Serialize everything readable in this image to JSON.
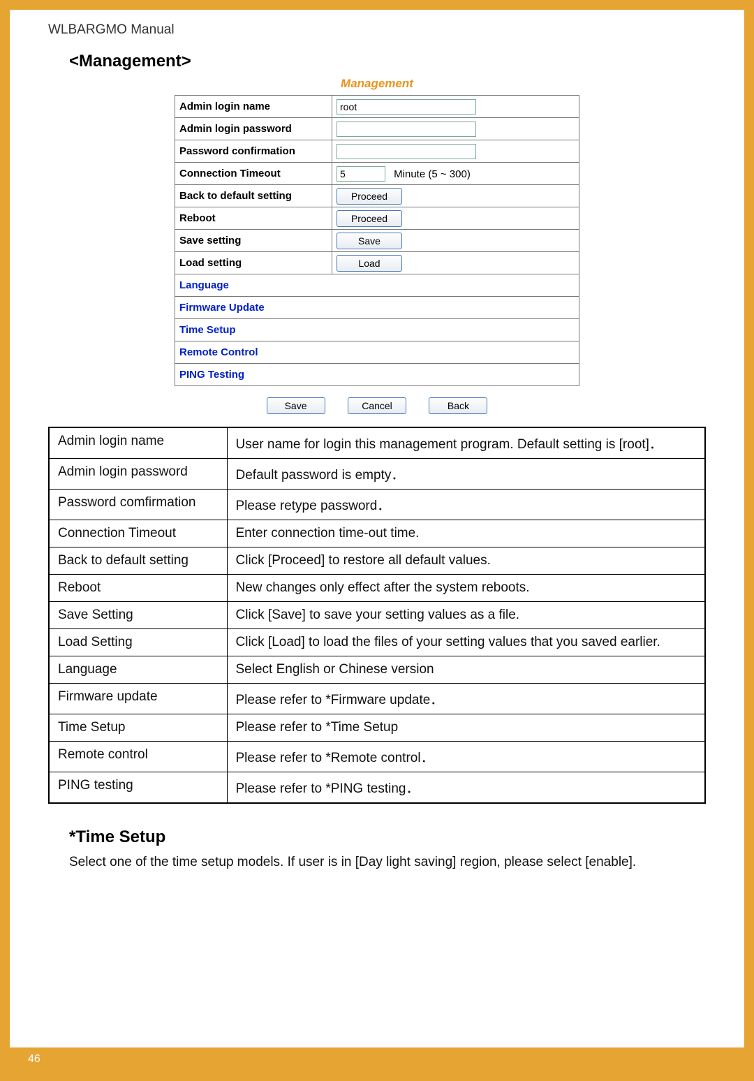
{
  "doc_title": "WLBARGMO Manual",
  "page_number": "46",
  "section_heading": "<Management>",
  "screenshot": {
    "title": "Management",
    "rows": {
      "admin_login_name": {
        "label": "Admin login name",
        "value": "root"
      },
      "admin_login_password": {
        "label": "Admin login password",
        "value": ""
      },
      "password_confirmation": {
        "label": "Password confirmation",
        "value": ""
      },
      "connection_timeout": {
        "label": "Connection Timeout",
        "value": "5",
        "hint": "Minute (5 ~ 300)"
      },
      "back_to_default": {
        "label": "Back to default setting",
        "button": "Proceed"
      },
      "reboot": {
        "label": "Reboot",
        "button": "Proceed"
      },
      "save_setting": {
        "label": "Save setting",
        "button": "Save"
      },
      "load_setting": {
        "label": "Load setting",
        "button": "Load"
      }
    },
    "links": [
      "Language",
      "Firmware Update",
      "Time Setup",
      "Remote Control",
      "PING Testing"
    ],
    "bottom_buttons": [
      "Save",
      "Cancel",
      "Back"
    ]
  },
  "desc_rows": [
    {
      "k": "Admin login name",
      "v": "User name for login this management program. Default setting is [root]．"
    },
    {
      "k": "Admin login password",
      "v": "Default password is empty．"
    },
    {
      "k": "Password comfirmation",
      "v": "Please retype password．"
    },
    {
      "k": "Connection Timeout",
      "v": "Enter connection time-out time."
    },
    {
      "k": "Back to default setting",
      "v": "Click [Proceed] to restore all default values."
    },
    {
      "k": "Reboot",
      "v": "New changes only effect after the system reboots."
    },
    {
      "k": "Save Setting",
      "v": "Click [Save] to save your setting values as a file."
    },
    {
      "k": "Load Setting",
      "v": "Click [Load] to load the files of your setting values that you saved earlier."
    },
    {
      "k": "Language",
      "v": "Select English or Chinese version"
    },
    {
      "k": "Firmware update",
      "v": "Please refer to *Firmware update．"
    },
    {
      "k": "Time Setup",
      "v": "Please refer to *Time Setup"
    },
    {
      "k": "Remote control",
      "v": "Please refer to *Remote control．"
    },
    {
      "k": "PING testing",
      "v": "Please refer to *PING testing．"
    }
  ],
  "section2": {
    "heading": "*Time Setup",
    "body": "Select one of the time setup models. If user is in [Day light saving] region, please select [enable]."
  }
}
